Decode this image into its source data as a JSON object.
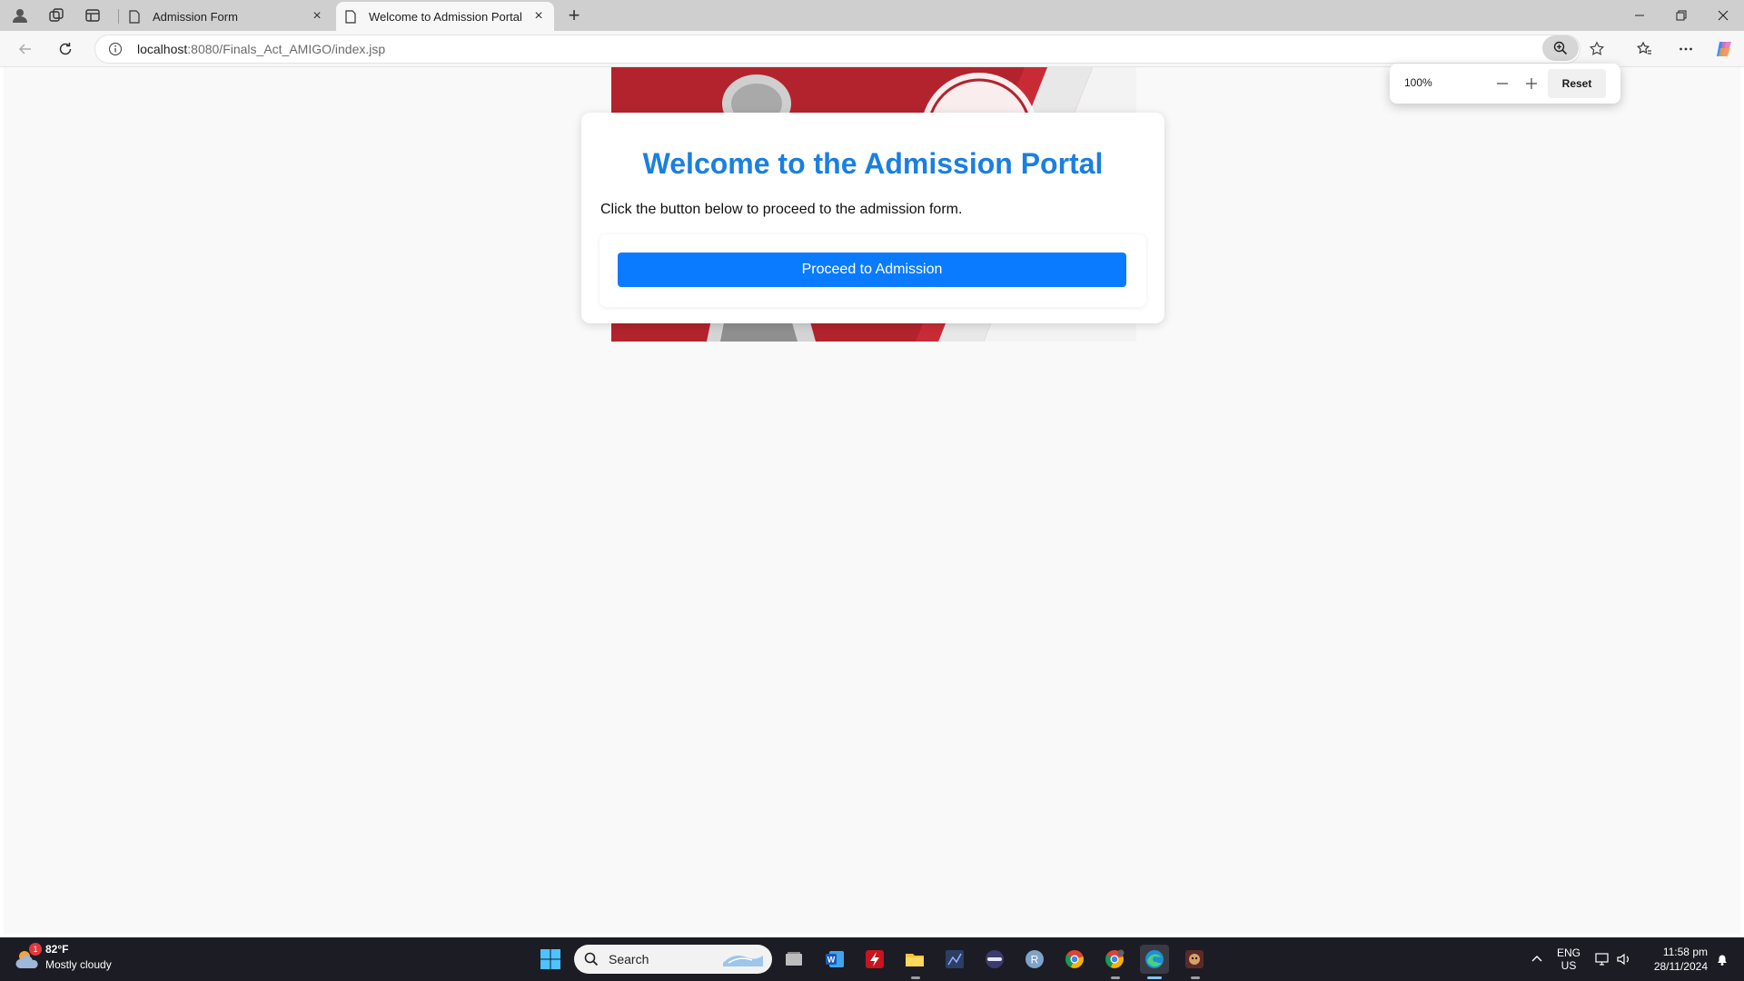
{
  "browser": {
    "tabs": [
      {
        "title": "Admission Form",
        "active": false
      },
      {
        "title": "Welcome to Admission Portal",
        "active": true
      }
    ],
    "url_host": "localhost",
    "url_path": ":8080/Finals_Act_AMIGO/index.jsp",
    "zoom_popup": {
      "value": "100%",
      "reset_label": "Reset"
    }
  },
  "page": {
    "heading": "Welcome to the Admission Portal",
    "instruction": "Click the button below to proceed to the admission form.",
    "button_label": "Proceed to Admission"
  },
  "taskbar": {
    "weather": {
      "temp": "82°F",
      "condition": "Mostly cloudy",
      "badge": "1"
    },
    "search_placeholder": "Search",
    "language": {
      "line1": "ENG",
      "line2": "US"
    },
    "clock": {
      "time": "11:58 pm",
      "date": "28/11/2024"
    },
    "apps": [
      "windows-start",
      "task-view",
      "word",
      "flash",
      "file-explorer",
      "network-tool",
      "media-tool",
      "r-studio",
      "chrome",
      "chrome-canary",
      "edge",
      "game-app"
    ]
  },
  "colors": {
    "accent": "#1a7fe0",
    "button": "#0a7bff",
    "banner_red": "#b3232d"
  }
}
